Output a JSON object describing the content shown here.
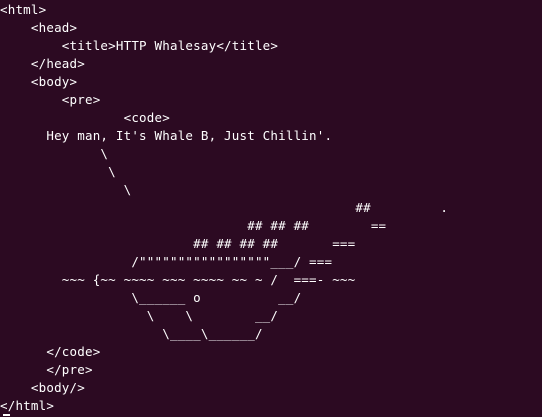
{
  "terminal": {
    "lines": [
      "<html>",
      "    <head>",
      "        <title>HTTP Whalesay</title>",
      "    </head>",
      "    <body>",
      "        <pre>",
      "                <code>",
      "      Hey man, It's Whale B, Just Chillin'.",
      "             \\",
      "              \\",
      "                \\",
      "                                              ##         .",
      "                                ## ## ##        ==",
      "                         ## ## ## ##       ===",
      "                 /\"\"\"\"\"\"\"\"\"\"\"\"\"\"\"\"\"___/ ===",
      "        ~~~ {~~ ~~~~ ~~~ ~~~~ ~~ ~ /  ===- ~~~",
      "                 \\______ o          __/",
      "                   \\    \\        __/",
      "                     \\____\\______/",
      "      </code>",
      "      </pre>",
      "    <body/>",
      "</html>"
    ]
  },
  "colors": {
    "background": "#2c0a22",
    "text": "#ffffff"
  }
}
